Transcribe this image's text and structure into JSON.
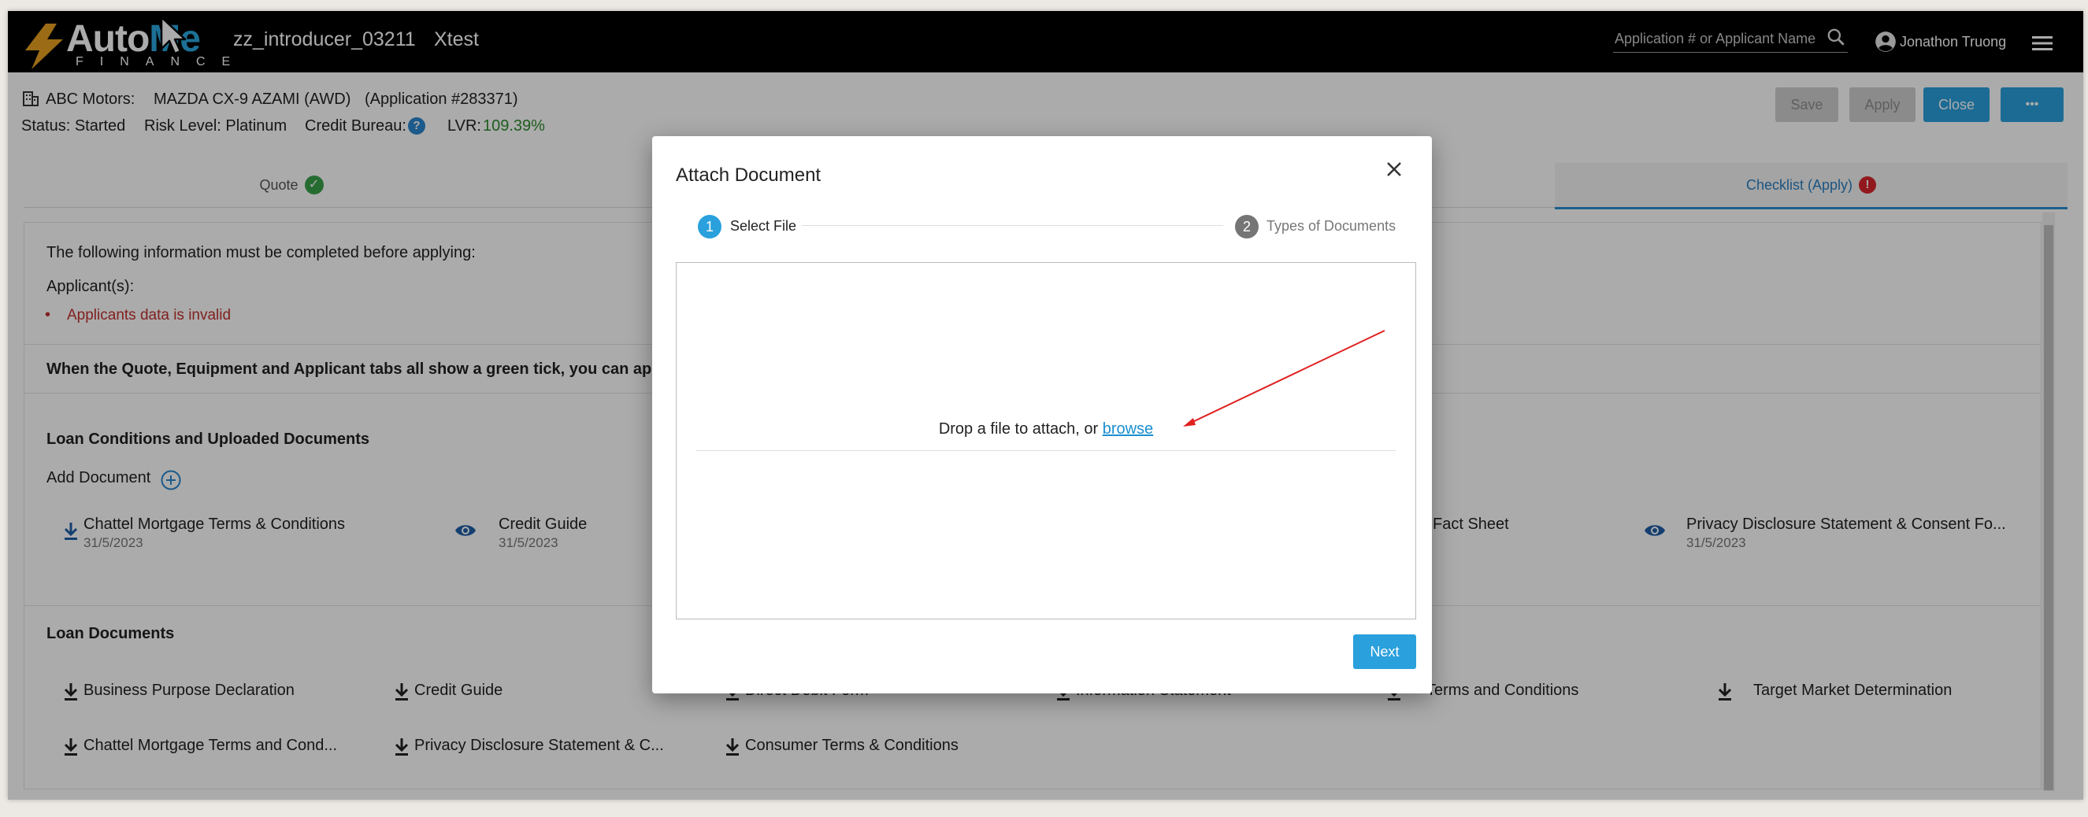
{
  "topbar": {
    "logo_main": "Auto",
    "logo_accent": "Me",
    "logo_sub": "FINANCE",
    "introducer": "zz_introducer_03211",
    "company": "Xtest",
    "search_placeholder": "Application # or Applicant Name",
    "user_name": "Jonathon Truong"
  },
  "application": {
    "dealer": "ABC Motors:",
    "vehicle": "MAZDA CX-9 AZAMI (AWD)",
    "app_number": "(Application #283371)",
    "status": "Status: Started",
    "risk": "Risk Level: Platinum",
    "credit_bureau": "Credit Bureau:",
    "lvr_label": "LVR:",
    "lvr_value": "109.39%"
  },
  "actions": {
    "save": "Save",
    "apply": "Apply",
    "close": "Close",
    "more": "•••"
  },
  "tabs": {
    "quote": "Quote",
    "checklist": "Checklist (Apply)"
  },
  "checklist": {
    "intro": "The following information must be completed before applying:",
    "applicants_label": "Applicant(s):",
    "error": "Applicants data is invalid",
    "green_tick_note": "When the Quote, Equipment and Applicant tabs all show a green tick, you can apply for"
  },
  "loan_conditions": {
    "heading": "Loan Conditions and Uploaded Documents",
    "add_document": "Add Document",
    "docs": [
      {
        "name": "Chattel Mortgage Terms & Conditions",
        "date": "31/5/2023"
      },
      {
        "name": "Credit Guide",
        "date": "31/5/2023"
      },
      {
        "name": "Fact Sheet",
        "date": ""
      },
      {
        "name": "Privacy Disclosure Statement & Consent Fo...",
        "date": "31/5/2023"
      }
    ]
  },
  "loan_documents": {
    "heading": "Loan Documents",
    "row1": [
      "Business Purpose Declaration",
      "Credit Guide",
      "Direct Debit Form",
      "Information Statement",
      "Terms and Conditions",
      "Target Market Determination"
    ],
    "row2": [
      "Chattel Mortgage Terms and Cond...",
      "Privacy Disclosure Statement & C...",
      "Consumer Terms & Conditions"
    ]
  },
  "modal": {
    "title": "Attach Document",
    "step1_num": "1",
    "step1_label": "Select File",
    "step2_num": "2",
    "step2_label": "Types of Documents",
    "drop_text": "Drop a file to attach, or",
    "browse": "browse",
    "next": "Next"
  },
  "colors": {
    "accent": "#2aa0dd",
    "error": "#c0312f",
    "success": "#3aa14a"
  }
}
